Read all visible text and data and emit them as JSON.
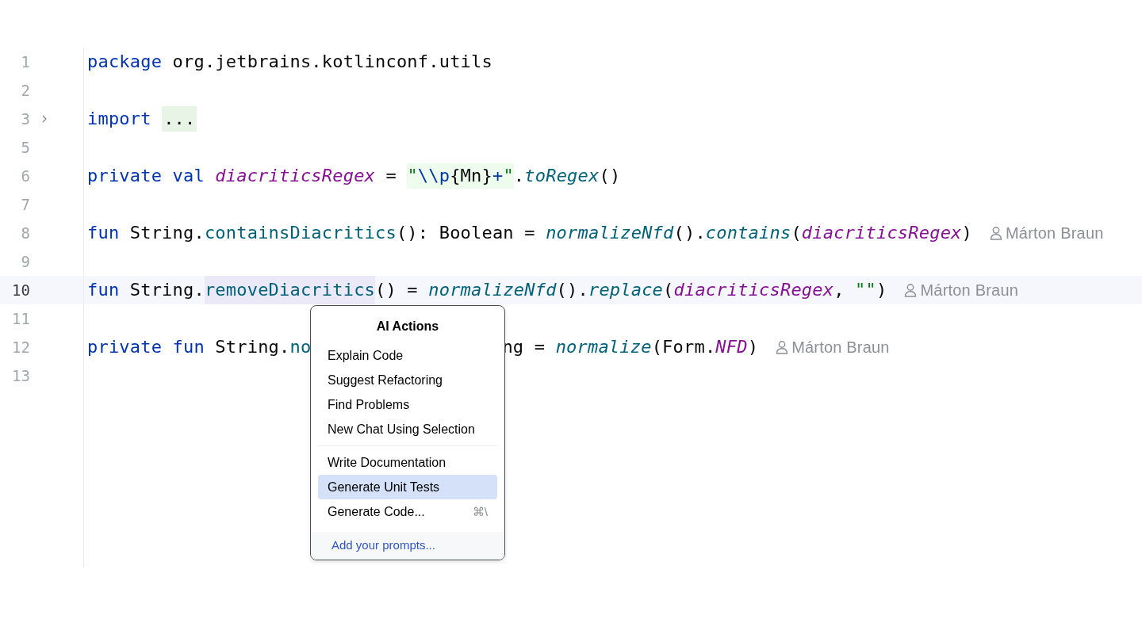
{
  "editor": {
    "lines": [
      {
        "number": "1",
        "current": false,
        "tokens": [
          {
            "kind": "keyword",
            "text": "package"
          },
          {
            "kind": "plain",
            "text": " org.jetbrains.kotlinconf.utils"
          }
        ]
      },
      {
        "number": "2",
        "current": false
      },
      {
        "number": "3",
        "current": false,
        "fold": {
          "expanded": false
        },
        "tokens": [
          {
            "kind": "keyword",
            "text": "import "
          },
          {
            "kind": "folded",
            "text": "..."
          }
        ]
      },
      {
        "number": "5",
        "current": false
      },
      {
        "number": "6",
        "current": false,
        "tokens": [
          {
            "kind": "keyword",
            "text": "private val "
          },
          {
            "kind": "property",
            "text": "diacriticsRegex"
          },
          {
            "kind": "plain",
            "text": " = "
          },
          {
            "kind": "regex-quote",
            "text": "\""
          },
          {
            "kind": "regex-escape",
            "text": "\\\\p"
          },
          {
            "kind": "regex-text",
            "text": "{Mn}"
          },
          {
            "kind": "regex-escape",
            "text": "+"
          },
          {
            "kind": "regex-quote",
            "text": "\""
          },
          {
            "kind": "plain",
            "text": "."
          },
          {
            "kind": "call",
            "text": "toRegex"
          },
          {
            "kind": "plain",
            "text": "()"
          }
        ]
      },
      {
        "number": "7",
        "current": false
      },
      {
        "number": "8",
        "current": false,
        "author": "Márton Braun",
        "tokens": [
          {
            "kind": "keyword",
            "text": "fun"
          },
          {
            "kind": "plain",
            "text": " String."
          },
          {
            "kind": "declaration",
            "text": "containsDiacritics"
          },
          {
            "kind": "plain",
            "text": "(): Boolean = "
          },
          {
            "kind": "call",
            "text": "normalizeNfd"
          },
          {
            "kind": "plain",
            "text": "()."
          },
          {
            "kind": "call",
            "text": "contains"
          },
          {
            "kind": "plain",
            "text": "("
          },
          {
            "kind": "property",
            "text": "diacriticsRegex"
          },
          {
            "kind": "plain",
            "text": ")"
          }
        ]
      },
      {
        "number": "9",
        "current": false
      },
      {
        "number": "10",
        "current": true,
        "author": "Márton Braun",
        "tokens": [
          {
            "kind": "keyword",
            "text": "fun"
          },
          {
            "kind": "plain",
            "text": " String."
          },
          {
            "kind": "declaration",
            "text": "removeDiacritics",
            "highlighted": true
          },
          {
            "kind": "plain",
            "text": "() = "
          },
          {
            "kind": "call",
            "text": "normalizeNfd"
          },
          {
            "kind": "plain",
            "text": "()."
          },
          {
            "kind": "call",
            "text": "replace"
          },
          {
            "kind": "plain",
            "text": "("
          },
          {
            "kind": "property",
            "text": "diacriticsRegex"
          },
          {
            "kind": "plain",
            "text": ", "
          },
          {
            "kind": "string",
            "text": "\"\""
          },
          {
            "kind": "plain",
            "text": ")"
          }
        ]
      },
      {
        "number": "11",
        "current": false
      },
      {
        "number": "12",
        "current": false,
        "author": "Márton Braun",
        "tokens": [
          {
            "kind": "keyword",
            "text": "private fun"
          },
          {
            "kind": "plain",
            "text": " String."
          },
          {
            "kind": "declaration",
            "text": "no"
          },
          {
            "kind": "covered"
          },
          {
            "kind": "plain",
            "text": "ng = "
          },
          {
            "kind": "call",
            "text": "normalize"
          },
          {
            "kind": "plain",
            "text": "(Form."
          },
          {
            "kind": "property",
            "text": "NFD"
          },
          {
            "kind": "plain",
            "text": ")"
          }
        ]
      },
      {
        "number": "13",
        "current": false
      }
    ]
  },
  "ai_actions_menu": {
    "title": "AI Actions",
    "groups": [
      [
        {
          "label": "Explain Code",
          "selected": false
        },
        {
          "label": "Suggest Refactoring",
          "selected": false
        },
        {
          "label": "Find Problems",
          "selected": false
        },
        {
          "label": "New Chat Using Selection",
          "selected": false
        }
      ],
      [
        {
          "label": "Write Documentation",
          "selected": false
        },
        {
          "label": "Generate Unit Tests",
          "selected": true
        },
        {
          "label": "Generate Code...",
          "shortcut": "⌘\\",
          "selected": false
        }
      ]
    ],
    "footer_link": "Add your prompts..."
  }
}
